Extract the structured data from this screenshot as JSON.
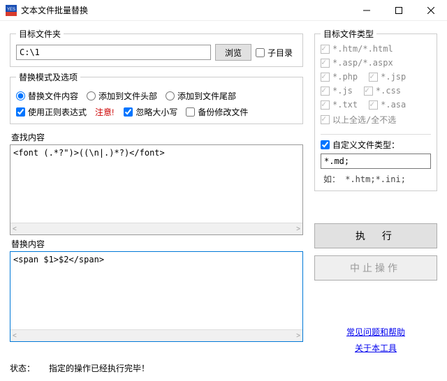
{
  "window": {
    "title": "文本文件批量替换"
  },
  "folder": {
    "legend": "目标文件夹",
    "path": "C:\\1",
    "browse": "浏览",
    "subdir": "子目录"
  },
  "mode": {
    "legend": "替换模式及选项",
    "r1": "替换文件内容",
    "r2": "添加到文件头部",
    "r3": "添加到文件尾部",
    "useRegex": "使用正则表达式",
    "regexWarn": "注意!",
    "ignoreCase": "忽略大小写",
    "backup": "备份修改文件"
  },
  "find": {
    "label": "查找内容",
    "value": "<font (.*?\")>((\\n|.)*?)</font>"
  },
  "replace": {
    "label": "替换内容",
    "value": "<span $1>$2</span>"
  },
  "types": {
    "legend": "目标文件类型",
    "t_html": "*.htm/*.html",
    "t_asp": "*.asp/*.aspx",
    "t_php": "*.php",
    "t_jsp": "*.jsp",
    "t_js": "*.js",
    "t_css": "*.css",
    "t_txt": "*.txt",
    "t_asa": "*.asa",
    "selectAll": "以上全选/全不选",
    "customLabel": "自定义文件类型：",
    "customValue": "*.md;",
    "hint": "如： *.htm;*.ini;"
  },
  "actions": {
    "execute": "执 行",
    "abort": "中止操作"
  },
  "links": {
    "faq": "常见问题和帮助",
    "about": "关于本工具"
  },
  "status": {
    "label": "状态：",
    "text": "指定的操作已经执行完毕！"
  }
}
